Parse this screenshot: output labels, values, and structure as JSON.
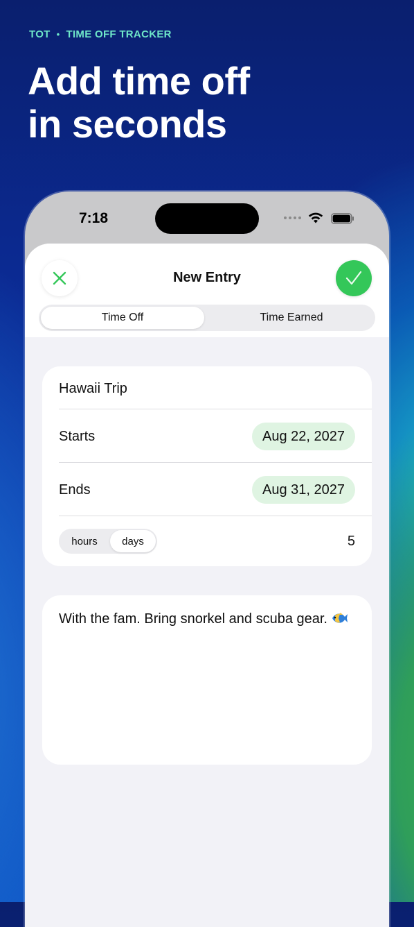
{
  "brand": {
    "name": "TOT",
    "separator": "•",
    "tagline": "TIME OFF TRACKER"
  },
  "headline": {
    "line1": "Add time off",
    "line2": "in seconds"
  },
  "status_bar": {
    "time": "7:18"
  },
  "sheet": {
    "title": "New Entry",
    "close_icon": "close-x-icon",
    "done_icon": "checkmark-icon",
    "tabs": [
      {
        "label": "Time Off",
        "selected": true
      },
      {
        "label": "Time Earned",
        "selected": false
      }
    ]
  },
  "entry": {
    "name": "Hawaii Trip",
    "starts_label": "Starts",
    "starts_value": "Aug 22, 2027",
    "ends_label": "Ends",
    "ends_value": "Aug 31, 2027",
    "units": [
      {
        "label": "hours",
        "selected": false
      },
      {
        "label": "days",
        "selected": true
      }
    ],
    "amount": "5"
  },
  "notes": {
    "text": "With the fam. Bring snorkel and scuba gear."
  },
  "colors": {
    "accent_green": "#34c759",
    "date_pill_bg": "#dff4e2",
    "eyebrow": "#6ee6c8"
  }
}
